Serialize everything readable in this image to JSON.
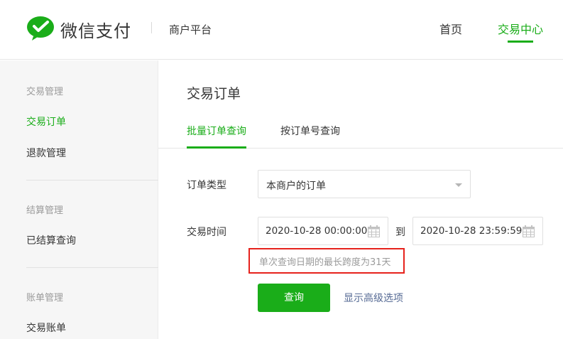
{
  "header": {
    "brand": "微信支付",
    "subbrand": "商户平台",
    "nav": {
      "home": "首页",
      "trade_center": "交易中心"
    }
  },
  "sidebar": {
    "groups": [
      {
        "title": "交易管理",
        "items": [
          "交易订单",
          "退款管理"
        ]
      },
      {
        "title": "结算管理",
        "items": [
          "已结算查询"
        ]
      },
      {
        "title": "账单管理",
        "items": [
          "交易账单"
        ]
      }
    ],
    "active_item": "交易订单"
  },
  "main": {
    "title": "交易订单",
    "tabs": [
      {
        "label": "批量订单查询",
        "active": true
      },
      {
        "label": "按订单号查询",
        "active": false
      }
    ],
    "form": {
      "order_type_label": "订单类型",
      "order_type_value": "本商户的订单",
      "time_label": "交易时间",
      "start_time": "2020-10-28 00:00:00",
      "to_label": "到",
      "end_time": "2020-10-28 23:59:59",
      "hint": "单次查询日期的最长跨度为31天",
      "query_button": "查询",
      "advanced_link": "显示高级选项"
    }
  },
  "colors": {
    "brand_green": "#1aad19",
    "link_blue": "#576b95",
    "highlight_red": "#e6221c"
  },
  "icons": [
    "wechat-pay-logo",
    "calendar-icon",
    "chevron-down-icon"
  ]
}
